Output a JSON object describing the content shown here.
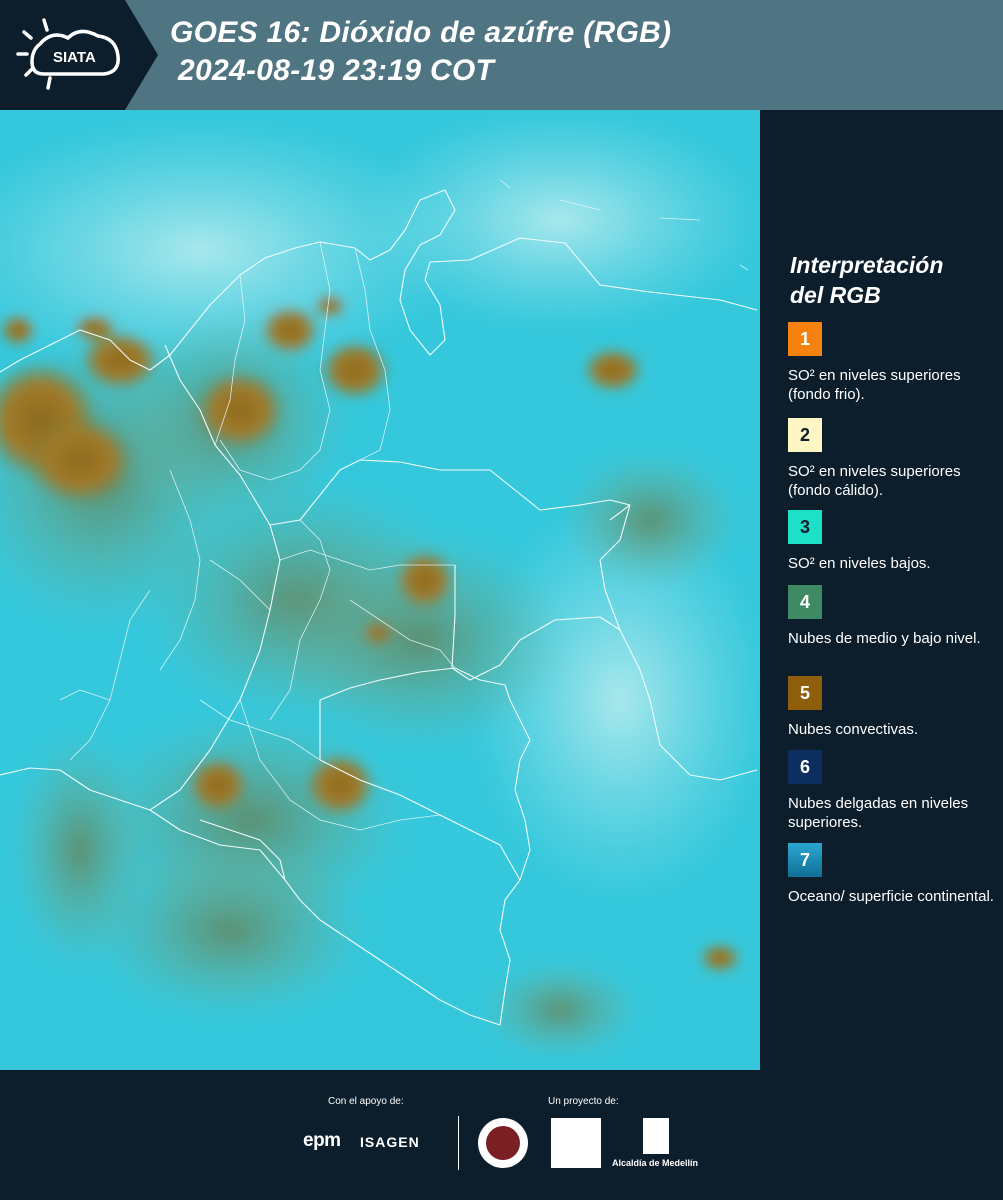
{
  "header": {
    "logo_text": "SIATA",
    "title_line1": "GOES 16: Dióxido de azúfre (RGB)",
    "title_line2": "2024-08-19 23:19 COT"
  },
  "legend": {
    "title_line1": "Interpretación",
    "title_line2": "del RGB",
    "items": [
      {
        "num": "1",
        "color": "#f5820e",
        "label": "SO² en niveles superiores (fondo frio)."
      },
      {
        "num": "2",
        "color": "#fff6c6",
        "label": "SO² en niveles superiores (fondo cálido)."
      },
      {
        "num": "3",
        "color": "#1ee0c6",
        "label": "SO² en niveles bajos."
      },
      {
        "num": "4",
        "color": "#3f8a63",
        "label": "Nubes de medio y bajo nivel."
      },
      {
        "num": "5",
        "color": "#8f5e0c",
        "label": "Nubes convectivas."
      },
      {
        "num": "6",
        "color": "#0d2f60",
        "label": "Nubes delgadas en niveles superiores."
      },
      {
        "num": "7",
        "color": "#1a95bd",
        "label": "Oceano/ superficie continental."
      }
    ]
  },
  "footer": {
    "support_label": "Con el apoyo de:",
    "project_label": "Un proyecto de:",
    "sponsor1": "epm",
    "sponsor2": "ISAGEN",
    "partner_alcaldia": "Alcaldía de Medellín"
  }
}
